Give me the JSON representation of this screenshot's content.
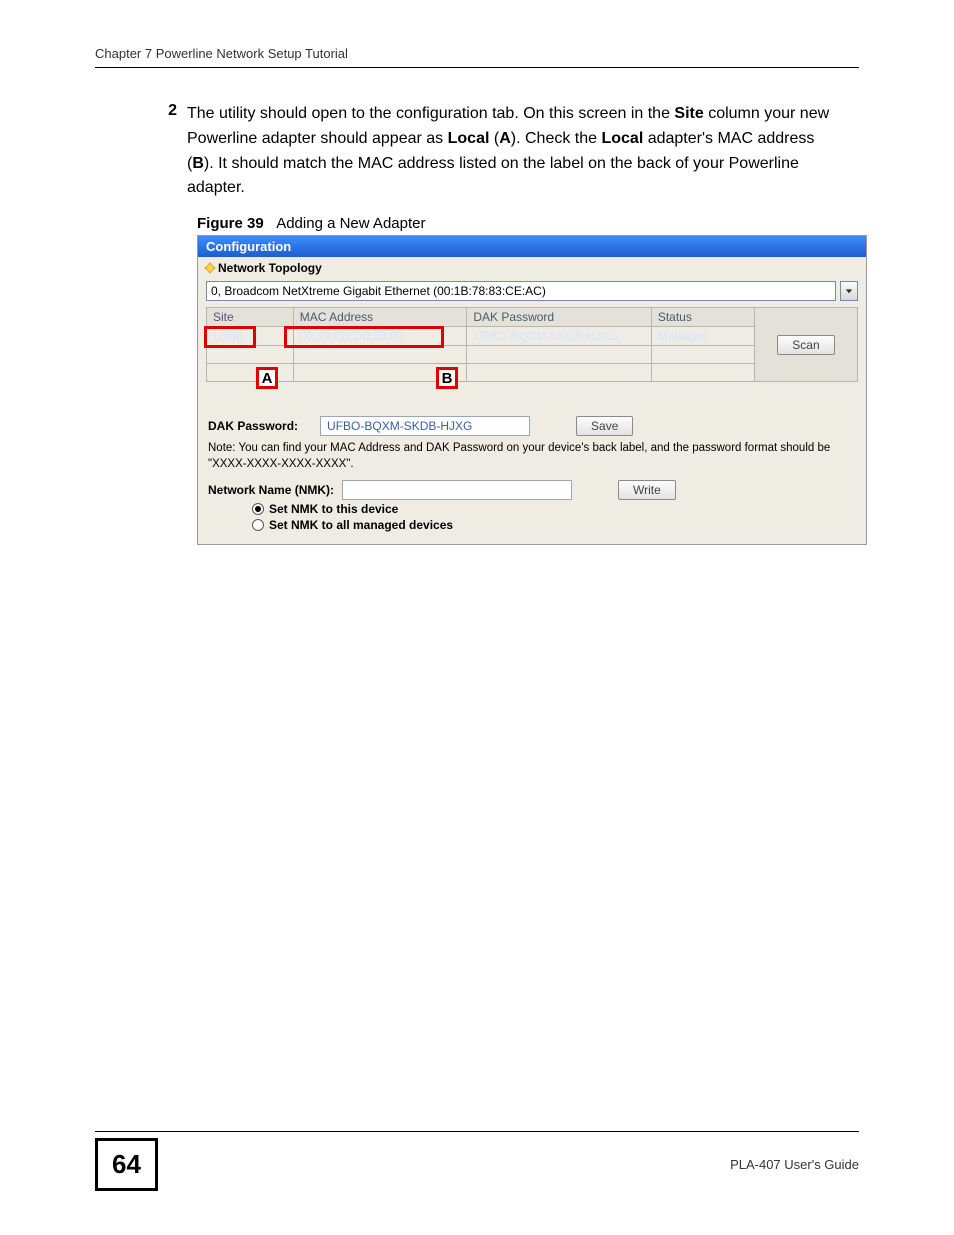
{
  "header": "Chapter 7 Powerline Network Setup Tutorial",
  "step": {
    "num": "2",
    "p1": "The utility should open to the configuration tab. On this screen in the ",
    "b1": "Site",
    "p2": " column your new Powerline adapter should appear as ",
    "b2": "Local",
    "p3": " (",
    "b3": "A",
    "p4": "). Check the ",
    "b4": "Local",
    "p5": " adapter's MAC address (",
    "b5": "B",
    "p6": "). It should match the MAC address listed on the label on the back of your Powerline adapter."
  },
  "figure": {
    "label": "Figure 39",
    "title": "Adding a New Adapter"
  },
  "app": {
    "tab": "Configuration",
    "section": "Network Topology",
    "nic": "0, Broadcom NetXtreme Gigabit Ethernet (00:1B:78:83:CE:AC)",
    "cols": {
      "site": "Site",
      "mac": "MAC Address",
      "dak": "DAK Password",
      "status": "Status",
      "scan": "Scan"
    },
    "row": {
      "site": "Local",
      "mac": "00:19:CB:DD:26:03",
      "dak": "UFBO-BQXM-SKDB-HJXG",
      "status": "Managed"
    },
    "dak_label": "DAK Password:",
    "dak_value": "UFBO-BQXM-SKDB-HJXG",
    "save": "Save",
    "note": "Note: You can find your MAC Address and DAK Password on your device's back label, and the password format should be \"XXXX-XXXX-XXXX-XXXX\".",
    "nmk_label": "Network Name (NMK):",
    "write": "Write",
    "radio1": "Set NMK to this device",
    "radio2": "Set NMK to all managed devices"
  },
  "callouts": {
    "A": "A",
    "B": "B"
  },
  "footer": {
    "page": "64",
    "guide": "PLA-407 User's Guide"
  }
}
